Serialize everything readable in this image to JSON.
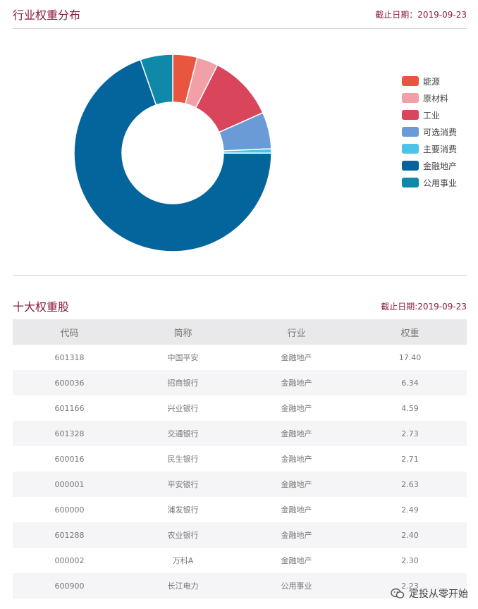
{
  "industry_section": {
    "title": "行业权重分布",
    "date_label": "截止日期：2019-09-23"
  },
  "chart_data": {
    "type": "pie",
    "categories": [
      "能源",
      "原材料",
      "工业",
      "可选消费",
      "主要消费",
      "金融地产",
      "公用事业"
    ],
    "values": [
      4.0,
      3.5,
      10.8,
      6.0,
      0.7,
      69.6,
      5.3
    ],
    "colors": [
      "#e8563f",
      "#f0a0a6",
      "#d9455b",
      "#6a9bd6",
      "#4ec3e8",
      "#03659c",
      "#0e8aa8"
    ],
    "legend_position": "right",
    "donut": true
  },
  "top_holdings": {
    "title": "十大权重股",
    "date_label": "截止日期:2019-09-23",
    "columns": [
      "代码",
      "简称",
      "行业",
      "权重"
    ],
    "rows": [
      [
        "601318",
        "中国平安",
        "金融地产",
        "17.40"
      ],
      [
        "600036",
        "招商银行",
        "金融地产",
        "6.34"
      ],
      [
        "601166",
        "兴业银行",
        "金融地产",
        "4.59"
      ],
      [
        "601328",
        "交通银行",
        "金融地产",
        "2.73"
      ],
      [
        "600016",
        "民生银行",
        "金融地产",
        "2.71"
      ],
      [
        "000001",
        "平安银行",
        "金融地产",
        "2.63"
      ],
      [
        "600000",
        "浦发银行",
        "金融地产",
        "2.49"
      ],
      [
        "601288",
        "农业银行",
        "金融地产",
        "2.40"
      ],
      [
        "000002",
        "万科A",
        "金融地产",
        "2.30"
      ],
      [
        "600900",
        "长江电力",
        "公用事业",
        "2.23"
      ]
    ]
  },
  "watermark": {
    "text": "定投从零开始",
    "icon": "wechat-icon"
  }
}
